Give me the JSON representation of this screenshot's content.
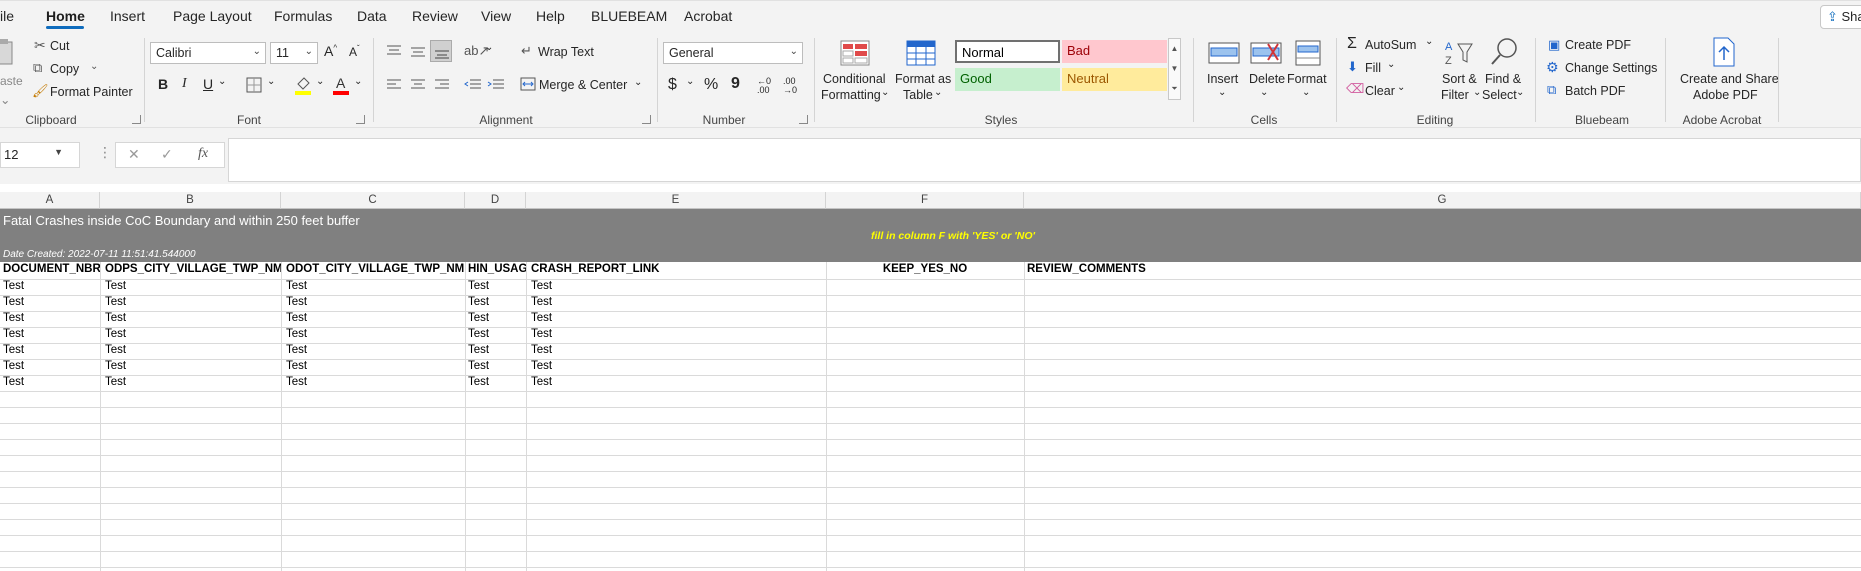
{
  "tabs": [
    "ile",
    "Home",
    "Insert",
    "Page Layout",
    "Formulas",
    "Data",
    "Review",
    "View",
    "Help",
    "BLUEBEAM",
    "Acrobat"
  ],
  "share_label": "Sha",
  "clipboard": {
    "paste": "aste",
    "cut": "Cut",
    "copy": "Copy",
    "format_painter": "Format Painter",
    "group": "Clipboard"
  },
  "font": {
    "name": "Calibri",
    "size": "11",
    "bold": "B",
    "italic": "I",
    "underline": "U",
    "group": "Font"
  },
  "alignment": {
    "wrap_text": "Wrap Text",
    "merge_center": "Merge & Center",
    "group": "Alignment"
  },
  "number": {
    "format": "General",
    "currency": "$",
    "percent": "%",
    "comma": "9",
    "group": "Number"
  },
  "styles": {
    "conditional": "Conditional",
    "conditional2": "Formatting",
    "format_as": "Format as",
    "table": "Table",
    "normal": "Normal",
    "bad": "Bad",
    "good": "Good",
    "neutral": "Neutral",
    "group": "Styles"
  },
  "cells_grp": {
    "insert": "Insert",
    "delete": "Delete",
    "format": "Format",
    "group": "Cells"
  },
  "editing": {
    "autosum": "AutoSum",
    "fill": "Fill",
    "clear": "Clear",
    "sort": "Sort &",
    "filter": "Filter",
    "find": "Find &",
    "select": "Select",
    "group": "Editing"
  },
  "bluebeam": {
    "create_pdf": "Create PDF",
    "change_settings": "Change Settings",
    "batch_pdf": "Batch PDF",
    "group": "Bluebeam"
  },
  "acrobat": {
    "line1": "Create and Share",
    "line2": "Adobe PDF",
    "group": "Adobe Acrobat"
  },
  "formula_bar": {
    "name_box": "12",
    "fx": "fx",
    "content": ""
  },
  "columns": [
    "A",
    "B",
    "C",
    "D",
    "E",
    "F",
    "G"
  ],
  "sheet": {
    "title": "Fatal Crashes inside CoC Boundary and within 250 feet buffer",
    "instruction": "fill in column F with 'YES' or 'NO'",
    "date_created": "Date Created: 2022-07-11 11:51:41.544000",
    "headers": [
      "DOCUMENT_NBR",
      "ODPS_CITY_VILLAGE_TWP_NME",
      "ODOT_CITY_VILLAGE_TWP_NME",
      "HIN_USAGE",
      "CRASH_REPORT_LINK",
      "KEEP_YES_NO",
      "REVIEW_COMMENTS"
    ],
    "rows": [
      [
        "Test",
        "Test",
        "Test",
        "Test",
        "Test",
        "",
        ""
      ],
      [
        "Test",
        "Test",
        "Test",
        "Test",
        "Test",
        "",
        ""
      ],
      [
        "Test",
        "Test",
        "Test",
        "Test",
        "Test",
        "",
        ""
      ],
      [
        "Test",
        "Test",
        "Test",
        "Test",
        "Test",
        "",
        ""
      ],
      [
        "Test",
        "Test",
        "Test",
        "Test",
        "Test",
        "",
        ""
      ],
      [
        "Test",
        "Test",
        "Test",
        "Test",
        "Test",
        "",
        ""
      ],
      [
        "Test",
        "Test",
        "Test",
        "Test",
        "Test",
        "",
        ""
      ]
    ]
  },
  "colors": {
    "banner": "#808080",
    "instruction": "#ffff00",
    "accent": "#0f6cbd",
    "bad_bg": "#ffc7ce",
    "bad_fg": "#9c0006",
    "good_bg": "#c6efce",
    "good_fg": "#006100",
    "neutral_bg": "#ffeb9c",
    "neutral_fg": "#9c5700"
  }
}
